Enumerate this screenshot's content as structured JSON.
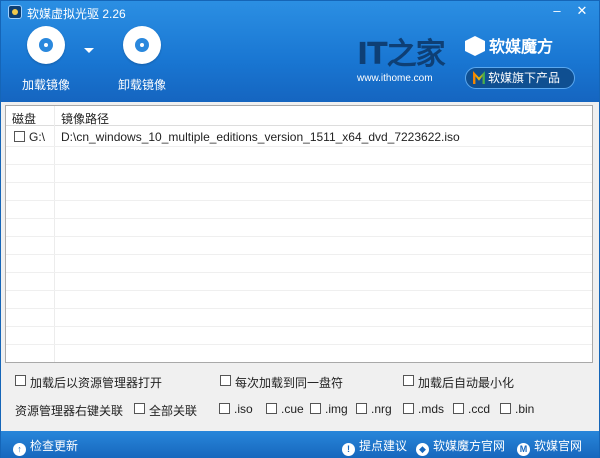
{
  "window": {
    "title": "软媒虚拟光驱 2.26"
  },
  "toolbar": {
    "mount_label": "加载镜像",
    "unmount_label": "卸载镜像"
  },
  "ads": {
    "ithome_logo": "IT之家",
    "ithome_url": "www.ithome.com",
    "brand_name": "软媒魔方",
    "products_label": "软媒旗下产品"
  },
  "table": {
    "headers": [
      "磁盘",
      "镜像路径"
    ],
    "rows": [
      {
        "drive": "G:\\",
        "path": "D:\\cn_windows_10_multiple_editions_version_1511_x64_dvd_7223622.iso",
        "checked": false
      }
    ]
  },
  "options": {
    "open_explorer": "加载后以资源管理器打开",
    "same_drive": "每次加载到同一盘符",
    "auto_minimize": "加载后自动最小化",
    "context_menu_label": "资源管理器右键关联",
    "associate_all": "全部关联",
    "formats": [
      ".iso",
      ".cue",
      ".img",
      ".nrg",
      ".mds",
      ".ccd",
      ".bin"
    ]
  },
  "footer": {
    "update_label": "检查更新",
    "suggest_label": "提点建议",
    "mofang_site_label": "软媒魔方官网",
    "ruanmei_site_label": "软媒官网"
  },
  "icons": {
    "mount": "disc-icon",
    "unmount": "disc-eject-icon",
    "update": "arrow-up-icon",
    "suggest": "lightbulb-icon",
    "mofang_site": "cube-icon",
    "ruanmei_site": "m-logo-icon"
  }
}
